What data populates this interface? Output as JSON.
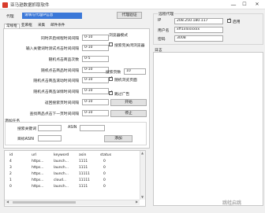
{
  "window": {
    "title": "亚马逊数据抓取软件",
    "min": "—",
    "max": "☐",
    "close": "✕"
  },
  "proxy": {
    "label": "代理",
    "value": "请填写代理IP信息",
    "button": "代理验证"
  },
  "tabs": [
    "常规框",
    "亚麻框",
    "采集",
    "邮件条件"
  ],
  "intervals": [
    {
      "label": "同时开启线程时间间隔",
      "value": "0-10"
    },
    {
      "label": "输入关键词时测试点击时间间隔",
      "value": "0-10"
    },
    {
      "label": "随机点击商品次数",
      "value": "0-5"
    },
    {
      "label": "随机点击商品时间间隔",
      "value": "0-10"
    },
    {
      "label": "随机点击商品滚动时间间隔",
      "value": "0-10"
    },
    {
      "label": "随机点击商品详情时间间隔",
      "value": "0-10"
    },
    {
      "label": "返回搜索页时间间隔",
      "value": "0-10"
    },
    {
      "label": "查找商品点击下一页时间间隔",
      "value": "0-10"
    }
  ],
  "options": {
    "browser_mode_label": "浏览器模式",
    "close_browser_label": "搜索完关闭浏览器",
    "search_pages_label": "搜索页数",
    "search_pages_value": "10",
    "random_stay_label": "随机浏览页面",
    "skip_ads_label": "跳过广告",
    "start_button": "开始",
    "stop_button": "停止"
  },
  "add_task": {
    "title": "添加任务",
    "keyword_label": "搜索关键词",
    "asin_label": "ASIN",
    "target_label": "目标ASIN",
    "add_button": "添加"
  },
  "table": {
    "headers": [
      "id",
      "url",
      "keyword",
      "asin",
      "status"
    ],
    "rows": [
      [
        "4",
        "https...",
        "launch...",
        "1111",
        "0"
      ],
      [
        "3",
        "https...",
        "launch...",
        "1111",
        "0"
      ],
      [
        "2",
        "https...",
        "launch...",
        "11111",
        "0"
      ],
      [
        "1",
        "https...",
        "cloud...",
        "11111",
        "0"
      ],
      [
        "0",
        "https...",
        "launch...",
        "1111",
        "0"
      ]
    ]
  },
  "right_panel": {
    "title": "远程代理",
    "ip_label": "IP",
    "ip_value": "208.250.180.117",
    "enable_label": "启用",
    "user_label": "用户名",
    "user_value": "xff1xlxxxxxx",
    "pass_label": "密码",
    "pass_value": "3008",
    "log_label": "日志"
  },
  "watermark": "跳蛙启跳"
}
